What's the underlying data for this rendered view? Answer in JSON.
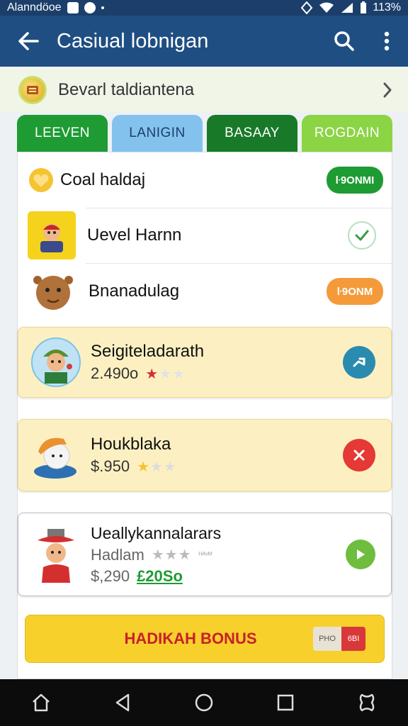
{
  "status_bar": {
    "carrier": "Alanndöoe",
    "battery": "113%",
    "icons": [
      "app-square-icon",
      "messenger-icon",
      "dot-icon",
      "location-icon",
      "wifi-icon",
      "signal-icon",
      "battery-icon"
    ]
  },
  "app_bar": {
    "title": "Casiual lobnigan",
    "icons": [
      "back-arrow-icon",
      "search-icon",
      "more-vert-icon"
    ]
  },
  "banner": {
    "text": "Bevarl taldiantena",
    "icons": [
      "coin-badge-icon",
      "chevron-right-icon"
    ]
  },
  "tabs": [
    {
      "label": "LEEVEN",
      "color": "#1e9b33"
    },
    {
      "label": "LANIGIN",
      "color": "#84c2ee"
    },
    {
      "label": "BASAAY",
      "color": "#187a28"
    },
    {
      "label": "ROGDAIN",
      "color": "#8bd444"
    }
  ],
  "list": {
    "header": {
      "title": "Coal haldaj",
      "badge": "ŀ9ONMI",
      "badge_color": "#1e9b33"
    },
    "row1": {
      "name": "Uevel Harnn",
      "status": "check"
    },
    "row2": {
      "name": "Bnanadulag",
      "badge": "ŀ9ONM",
      "badge_color": "#f49a3a"
    }
  },
  "cards": [
    {
      "title": "Seigiteladarath",
      "price": "2.490o",
      "rating_filled": 1,
      "rating_total": 3,
      "action_icon": "arrow-icon",
      "action_color": "#2a8bb0"
    },
    {
      "title": "Houkblaka",
      "price": "$.950",
      "rating_filled": 1,
      "rating_total": 3,
      "action_icon": "close-icon",
      "action_color": "#e53935"
    },
    {
      "title": "Ueallykannalarars",
      "subtitle": "Hadlam",
      "price": "$,290",
      "sale_price": "£20So",
      "rating_filled": 0,
      "rating_total": 3,
      "rating_extra": "ᴴᴬᵛᴹ",
      "action_icon": "play-icon",
      "action_color": "#6fbd3f"
    }
  ],
  "bonus": {
    "label": "HADIKAH BONUS",
    "tag_left": "PHO",
    "tag_right": "6BI"
  },
  "nav_bar": {
    "icons": [
      "home-icon",
      "back-icon",
      "circle-home-icon",
      "recents-icon",
      "custom-gesture-icon"
    ]
  },
  "colors": {
    "app_bar": "#1f4f82",
    "status_bar": "#1b3f6a",
    "card_yellow": "#fcf0c2",
    "bonus": "#f7d02b",
    "bonus_text": "#c8202a"
  }
}
